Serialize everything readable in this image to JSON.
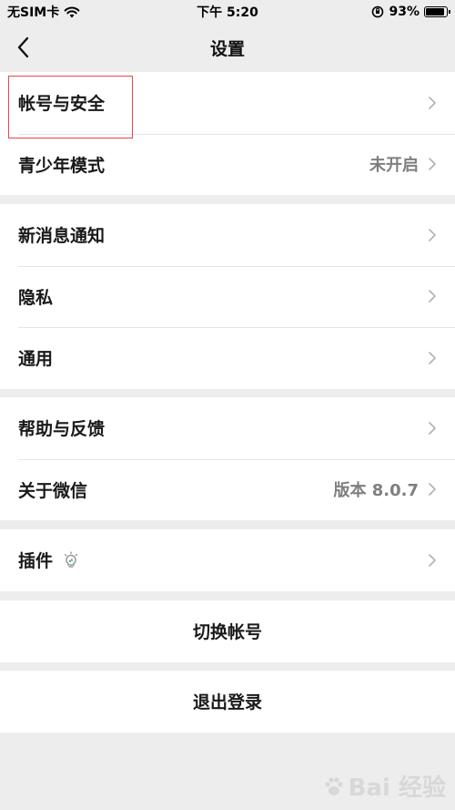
{
  "status_bar": {
    "carrier": "无SIM卡",
    "time": "下午 5:20",
    "battery_percent": "93%",
    "battery_level": 0.93
  },
  "nav": {
    "title": "设置",
    "back_icon": "chevron-left-icon"
  },
  "groups": [
    {
      "items": [
        {
          "label": "帐号与安全",
          "value": ""
        },
        {
          "label": "青少年模式",
          "value": "未开启"
        }
      ]
    },
    {
      "items": [
        {
          "label": "新消息通知",
          "value": ""
        },
        {
          "label": "隐私",
          "value": ""
        },
        {
          "label": "通用",
          "value": ""
        }
      ]
    },
    {
      "items": [
        {
          "label": "帮助与反馈",
          "value": ""
        },
        {
          "label": "关于微信",
          "value": "版本 8.0.7"
        }
      ]
    },
    {
      "items": [
        {
          "label": "插件",
          "icon": "lightbulb-icon"
        }
      ]
    }
  ],
  "actions": {
    "switch_account": "切换帐号",
    "logout": "退出登录"
  },
  "highlight_color": "#e8454a",
  "watermark": {
    "text": "Bai 经验",
    "icon": "paw-icon"
  }
}
